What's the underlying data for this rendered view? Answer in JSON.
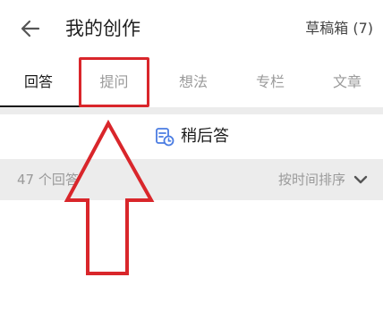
{
  "header": {
    "back_icon": "arrow-left-icon",
    "title": "我的创作",
    "drafts_label": "草稿箱 (7)"
  },
  "tabs": [
    {
      "label": "回答",
      "active": true
    },
    {
      "label": "提问",
      "active": false
    },
    {
      "label": "想法",
      "active": false
    },
    {
      "label": "专栏",
      "active": false
    },
    {
      "label": "文章",
      "active": false
    }
  ],
  "later": {
    "icon": "document-clock-icon",
    "label": "稍后答"
  },
  "list_header": {
    "count_label": "47 个回答",
    "sort_label": "按时间排序",
    "sort_icon": "chevron-down-icon"
  },
  "colors": {
    "accent": "#4a7ce2",
    "annotation_red": "#d9262b",
    "muted_text": "#9a9a9a",
    "divider_gray": "#ececec"
  }
}
